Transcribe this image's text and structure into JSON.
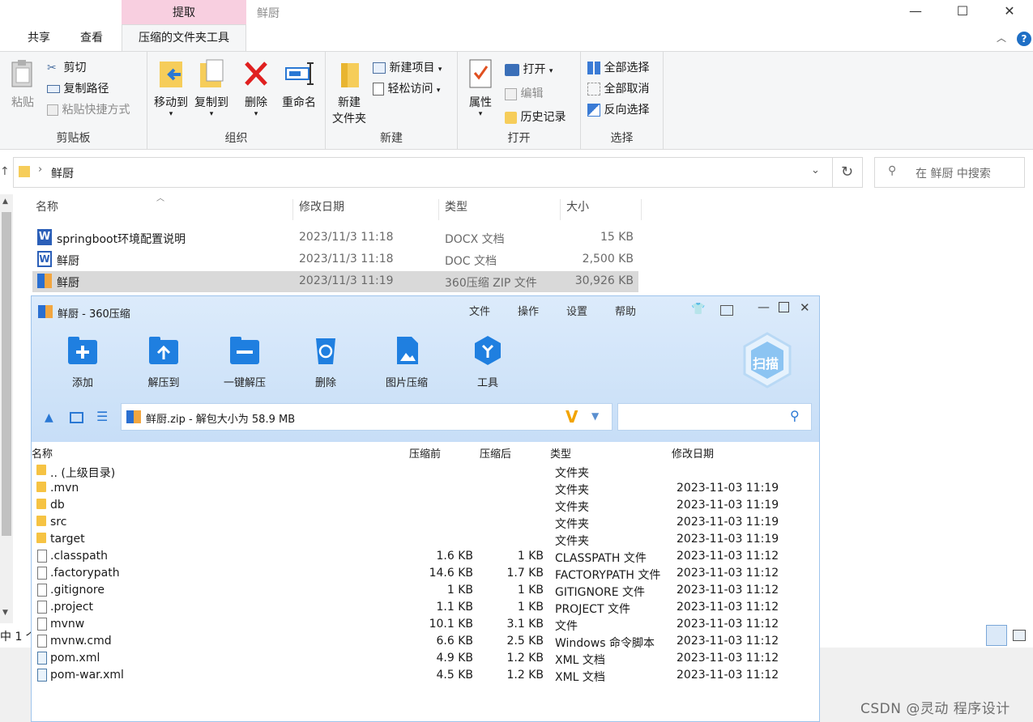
{
  "explorer": {
    "context_tab": "提取",
    "window_title": "鲜厨",
    "tabs": {
      "share": "共享",
      "view": "查看",
      "compressed_tools": "压缩的文件夹工具"
    },
    "ribbon": {
      "clipboard": {
        "paste": "粘贴",
        "cut": "剪切",
        "copy_path": "复制路径",
        "paste_shortcut": "粘贴快捷方式",
        "group": "剪贴板"
      },
      "organize": {
        "move_to": "移动到",
        "copy_to": "复制到",
        "delete": "删除",
        "rename": "重命名",
        "group": "组织"
      },
      "new": {
        "new_folder_1": "新建",
        "new_folder_2": "文件夹",
        "new_item": "新建项目",
        "easy_access": "轻松访问",
        "group": "新建"
      },
      "open": {
        "properties": "属性",
        "open": "打开",
        "edit": "编辑",
        "history": "历史记录",
        "group": "打开"
      },
      "select": {
        "select_all": "全部选择",
        "select_none": "全部取消",
        "invert": "反向选择",
        "group": "选择"
      }
    },
    "address": {
      "location": "鲜厨",
      "search_placeholder": "在 鲜厨 中搜索"
    },
    "columns": {
      "name": "名称",
      "modified": "修改日期",
      "type": "类型",
      "size": "大小"
    },
    "files": [
      {
        "name": "springboot环境配置说明",
        "modified": "2023/11/3 11:18",
        "type": "DOCX 文档",
        "size": "15 KB"
      },
      {
        "name": "鲜厨",
        "modified": "2023/11/3 11:18",
        "type": "DOC 文档",
        "size": "2,500 KB"
      },
      {
        "name": "鲜厨",
        "modified": "2023/11/3 11:19",
        "type": "360压缩 ZIP 文件",
        "size": "30,926 KB"
      }
    ],
    "status_text": "中 1 个"
  },
  "zip": {
    "title": "鲜厨 - 360压缩",
    "menu": {
      "file": "文件",
      "ops": "操作",
      "settings": "设置",
      "help": "帮助"
    },
    "toolbar": {
      "add": "添加",
      "extract_to": "解压到",
      "one_click": "一键解压",
      "delete": "删除",
      "img_compress": "图片压缩",
      "tools": "工具"
    },
    "scan": "扫描",
    "path": "鲜厨.zip - 解包大小为 58.9 MB",
    "columns": {
      "name": "名称",
      "before": "压缩前",
      "after": "压缩后",
      "type": "类型",
      "modified": "修改日期"
    },
    "rows": [
      {
        "kind": "folder",
        "name": ".. (上级目录)",
        "before": "",
        "after": "",
        "type": "文件夹",
        "modified": ""
      },
      {
        "kind": "folder",
        "name": ".mvn",
        "before": "",
        "after": "",
        "type": "文件夹",
        "modified": "2023-11-03 11:19"
      },
      {
        "kind": "folder",
        "name": "db",
        "before": "",
        "after": "",
        "type": "文件夹",
        "modified": "2023-11-03 11:19"
      },
      {
        "kind": "folder",
        "name": "src",
        "before": "",
        "after": "",
        "type": "文件夹",
        "modified": "2023-11-03 11:19"
      },
      {
        "kind": "folder",
        "name": "target",
        "before": "",
        "after": "",
        "type": "文件夹",
        "modified": "2023-11-03 11:19"
      },
      {
        "kind": "doc",
        "name": ".classpath",
        "before": "1.6 KB",
        "after": "1 KB",
        "type": "CLASSPATH 文件",
        "modified": "2023-11-03 11:12"
      },
      {
        "kind": "doc",
        "name": ".factorypath",
        "before": "14.6 KB",
        "after": "1.7 KB",
        "type": "FACTORYPATH 文件",
        "modified": "2023-11-03 11:12"
      },
      {
        "kind": "doc",
        "name": ".gitignore",
        "before": "1 KB",
        "after": "1 KB",
        "type": "GITIGNORE 文件",
        "modified": "2023-11-03 11:12"
      },
      {
        "kind": "doc",
        "name": ".project",
        "before": "1.1 KB",
        "after": "1 KB",
        "type": "PROJECT 文件",
        "modified": "2023-11-03 11:12"
      },
      {
        "kind": "doc",
        "name": "mvnw",
        "before": "10.1 KB",
        "after": "3.1 KB",
        "type": "文件",
        "modified": "2023-11-03 11:12"
      },
      {
        "kind": "cmd",
        "name": "mvnw.cmd",
        "before": "6.6 KB",
        "after": "2.5 KB",
        "type": "Windows 命令脚本",
        "modified": "2023-11-03 11:12"
      },
      {
        "kind": "xml",
        "name": "pom.xml",
        "before": "4.9 KB",
        "after": "1.2 KB",
        "type": "XML 文档",
        "modified": "2023-11-03 11:12"
      },
      {
        "kind": "xml",
        "name": "pom-war.xml",
        "before": "4.5 KB",
        "after": "1.2 KB",
        "type": "XML 文档",
        "modified": "2023-11-03 11:12"
      }
    ]
  },
  "watermark": "CSDN @灵动 程序设计"
}
